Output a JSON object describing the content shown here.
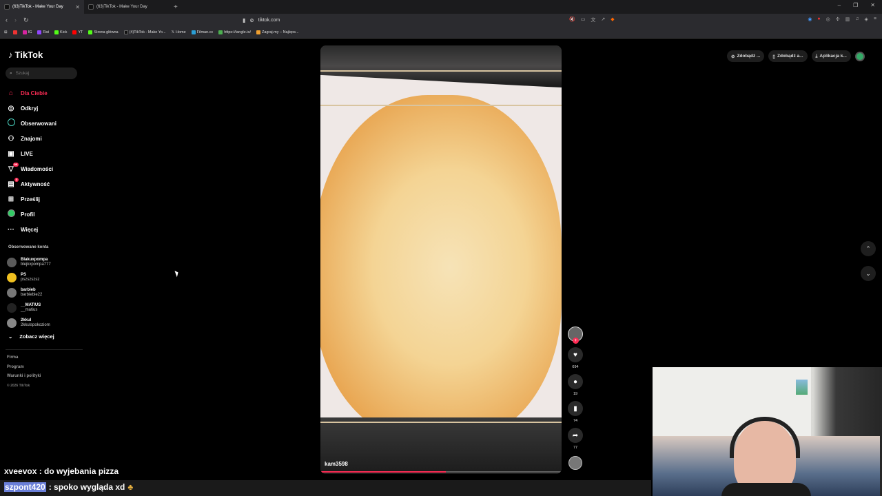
{
  "browser": {
    "tabs": [
      {
        "title": "(63)TikTok - Make Your Day",
        "active": true
      },
      {
        "title": "(63)TikTok - Make Your Day",
        "active": false
      }
    ],
    "url": "tiktok.com",
    "bookmarks": [
      {
        "label": "IG",
        "color": "#d6249f"
      },
      {
        "label": "Rat",
        "color": "#9146ff"
      },
      {
        "label": "Kick",
        "color": "#53fc18"
      },
      {
        "label": "YT",
        "color": "#ff0000"
      },
      {
        "label": "Strona główna",
        "color": "#53fc18"
      },
      {
        "label": "(4)TikTok - Make Yo...",
        "color": "#111111"
      },
      {
        "label": "Home",
        "color": "#ffffff"
      },
      {
        "label": "Filman.cc",
        "color": "#2a9fd6"
      },
      {
        "label": "https://tangle.io/",
        "color": "#4caf50"
      },
      {
        "label": "Zagraj.my – Najleps...",
        "color": "#f0a030"
      }
    ]
  },
  "tiktok": {
    "logo": "TikTok",
    "search_placeholder": "Szukaj",
    "nav": [
      {
        "label": "Dla Ciebie",
        "icon": "home-icon"
      },
      {
        "label": "Odkryj",
        "icon": "compass-icon"
      },
      {
        "label": "Obserwowani",
        "icon": "following-icon"
      },
      {
        "label": "Znajomi",
        "icon": "friends-icon"
      },
      {
        "label": "LIVE",
        "icon": "live-icon"
      },
      {
        "label": "Wiadomości",
        "icon": "messages-icon",
        "badge": "99"
      },
      {
        "label": "Aktywność",
        "icon": "activity-icon",
        "badge": "3"
      },
      {
        "label": "Prześlij",
        "icon": "upload-icon"
      },
      {
        "label": "Profil",
        "icon": "profile-icon"
      },
      {
        "label": "Więcej",
        "icon": "more-icon"
      }
    ],
    "followed_title": "Obserwowane konta",
    "followed": [
      {
        "name": "Blakuxpompa",
        "user": "blejkxpompa777"
      },
      {
        "name": "PS",
        "user": "pszszszsz"
      },
      {
        "name": "barbieb",
        "user": "barbiebie22"
      },
      {
        "name": "__MATIUS",
        "user": "__matius"
      },
      {
        "name": "2kkul",
        "user": "2kkulspokoziom"
      }
    ],
    "see_more": "Zobacz więcej",
    "footer": [
      "Firma",
      "Program",
      "Warunki i polityki"
    ],
    "copyright": "© 2026 TikTok",
    "video": {
      "author": "kam3598",
      "progress": 0.52
    },
    "actions": {
      "likes": "694",
      "comments": "19",
      "saves": "74",
      "shares": "77"
    },
    "topright": [
      "Zdobądź ...",
      "Zdobądź a...",
      "Aplikacja k..."
    ]
  },
  "chat": {
    "line1": "xveevox : do wyjebania pizza",
    "line2_user": "szpont420",
    "line2_text": ": spoko wygląda  xd"
  }
}
